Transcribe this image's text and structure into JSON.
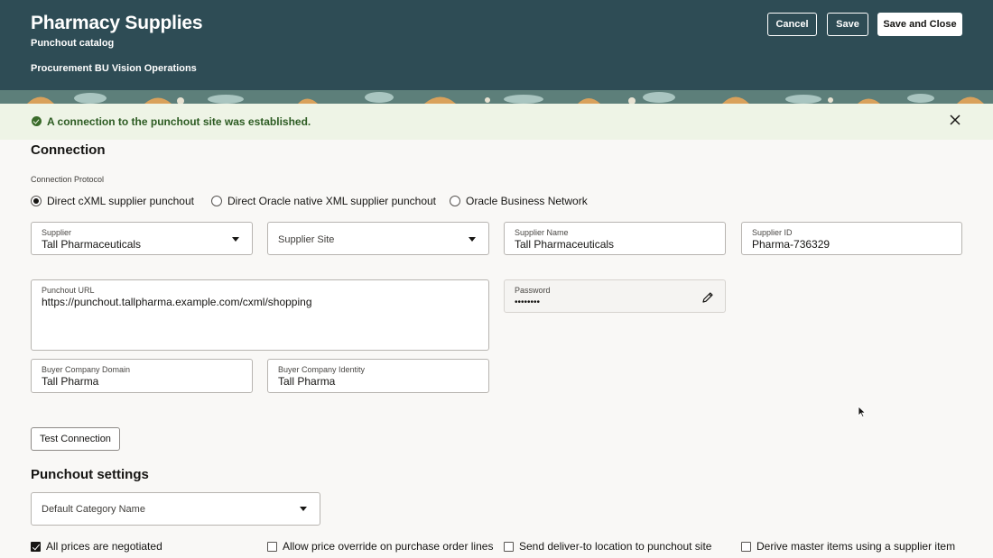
{
  "header": {
    "title": "Pharmacy Supplies",
    "subtitle": "Punchout catalog",
    "business_unit": "Procurement BU Vision Operations",
    "cancel_label": "Cancel",
    "save_label": "Save",
    "save_close_label": "Save and Close"
  },
  "banner": {
    "message": "A connection to the punchout site was established.",
    "status_icon": "check-circle-icon",
    "close_icon": "close-icon"
  },
  "connection": {
    "section_title": "Connection",
    "protocol_caption": "Connection Protocol",
    "protocols": [
      {
        "label": "Direct cXML supplier punchout",
        "selected": true
      },
      {
        "label": "Direct Oracle native XML supplier punchout",
        "selected": false
      },
      {
        "label": "Oracle Business Network",
        "selected": false
      }
    ],
    "supplier": {
      "label": "Supplier",
      "value": "Tall Pharmaceuticals"
    },
    "supplier_site": {
      "placeholder": "Supplier Site"
    },
    "supplier_name": {
      "label": "Supplier Name",
      "value": "Tall Pharmaceuticals"
    },
    "supplier_id": {
      "label": "Supplier ID",
      "value": "Pharma-736329"
    },
    "punchout_url": {
      "label": "Punchout URL",
      "value": "https://punchout.tallpharma.example.com/cxml/shopping"
    },
    "password": {
      "label": "Password",
      "value": "••••••••"
    },
    "buyer_domain": {
      "label": "Buyer Company Domain",
      "value": "Tall Pharma"
    },
    "buyer_identity": {
      "label": "Buyer Company Identity",
      "value": "Tall Pharma"
    },
    "test_button_label": "Test Connection"
  },
  "punchout_settings": {
    "section_title": "Punchout settings",
    "default_category": {
      "placeholder": "Default Category Name"
    },
    "options": [
      {
        "label": "All prices are negotiated",
        "checked": true
      },
      {
        "label": "Allow price override on purchase order lines",
        "checked": false
      },
      {
        "label": "Send deliver-to location to punchout site",
        "checked": false
      },
      {
        "label": "Derive master items using a supplier item",
        "checked": false
      }
    ]
  },
  "colors": {
    "header_bg": "#2e4c55",
    "banner_bg": "#eef4e6",
    "success_text": "#2c5b22",
    "page_bg": "#f9f8f6"
  }
}
